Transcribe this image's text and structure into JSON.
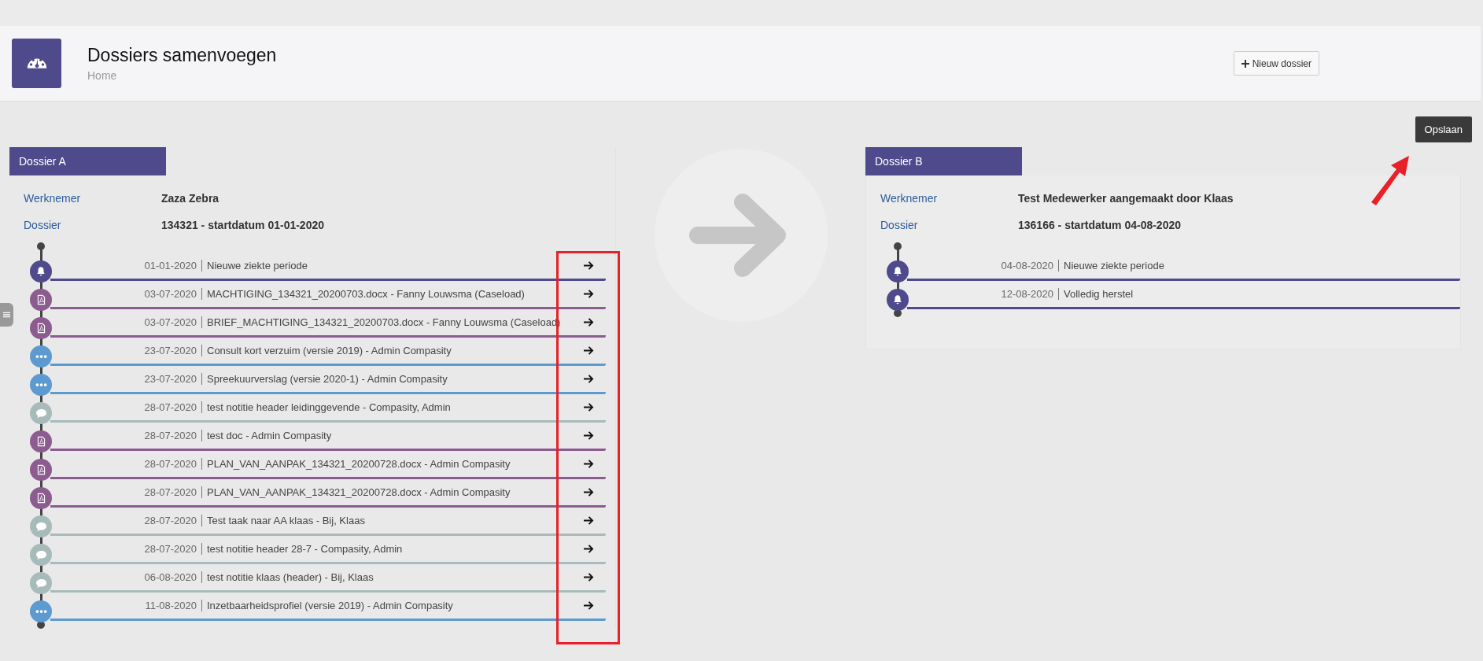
{
  "header": {
    "title": "Dossiers samenvoegen",
    "breadcrumb": "Home",
    "new_button": "Nieuw dossier"
  },
  "save_button": "Opslaan",
  "dossiers": [
    {
      "tab": "Dossier A",
      "fields": [
        {
          "label": "Werknemer",
          "value": "Zaza Zebra"
        },
        {
          "label": "Dossier",
          "value": "134321 - startdatum 01-01-2020"
        }
      ],
      "transfer_arrows": true,
      "events": [
        {
          "kind": "alert",
          "date": "01-01-2020",
          "text": "Nieuwe ziekte periode"
        },
        {
          "kind": "document",
          "date": "03-07-2020",
          "text": "MACHTIGING_134321_20200703.docx - Fanny Louwsma (Caseload)"
        },
        {
          "kind": "document",
          "date": "03-07-2020",
          "text": "BRIEF_MACHTIGING_134321_20200703.docx - Fanny Louwsma (Caseload)"
        },
        {
          "kind": "form",
          "date": "23-07-2020",
          "text": "Consult kort verzuim (versie 2019) - Admin Compasity"
        },
        {
          "kind": "form",
          "date": "23-07-2020",
          "text": "Spreekuurverslag (versie 2020-1) - Admin Compasity"
        },
        {
          "kind": "note",
          "date": "28-07-2020",
          "text": "test notitie header leidinggevende - Compasity, Admin"
        },
        {
          "kind": "document",
          "date": "28-07-2020",
          "text": "test doc - Admin Compasity"
        },
        {
          "kind": "document",
          "date": "28-07-2020",
          "text": "PLAN_VAN_AANPAK_134321_20200728.docx - Admin Compasity"
        },
        {
          "kind": "document",
          "date": "28-07-2020",
          "text": "PLAN_VAN_AANPAK_134321_20200728.docx - Admin Compasity"
        },
        {
          "kind": "note",
          "date": "28-07-2020",
          "text": "Test taak naar AA klaas - Bij, Klaas"
        },
        {
          "kind": "note",
          "date": "28-07-2020",
          "text": "test notitie header 28-7 - Compasity, Admin"
        },
        {
          "kind": "note",
          "date": "06-08-2020",
          "text": "test notitie klaas (header) - Bij, Klaas"
        },
        {
          "kind": "form",
          "date": "11-08-2020",
          "text": "Inzetbaarheidsprofiel (versie 2019) - Admin Compasity"
        }
      ]
    },
    {
      "tab": "Dossier B",
      "fields": [
        {
          "label": "Werknemer",
          "value": "Test Medewerker aangemaakt door Klaas"
        },
        {
          "label": "Dossier",
          "value": "136166 - startdatum 04-08-2020"
        }
      ],
      "transfer_arrows": false,
      "events": [
        {
          "kind": "alert",
          "date": "04-08-2020",
          "text": "Nieuwe ziekte periode"
        },
        {
          "kind": "alert",
          "date": "12-08-2020",
          "text": "Volledig herstel"
        }
      ]
    }
  ]
}
